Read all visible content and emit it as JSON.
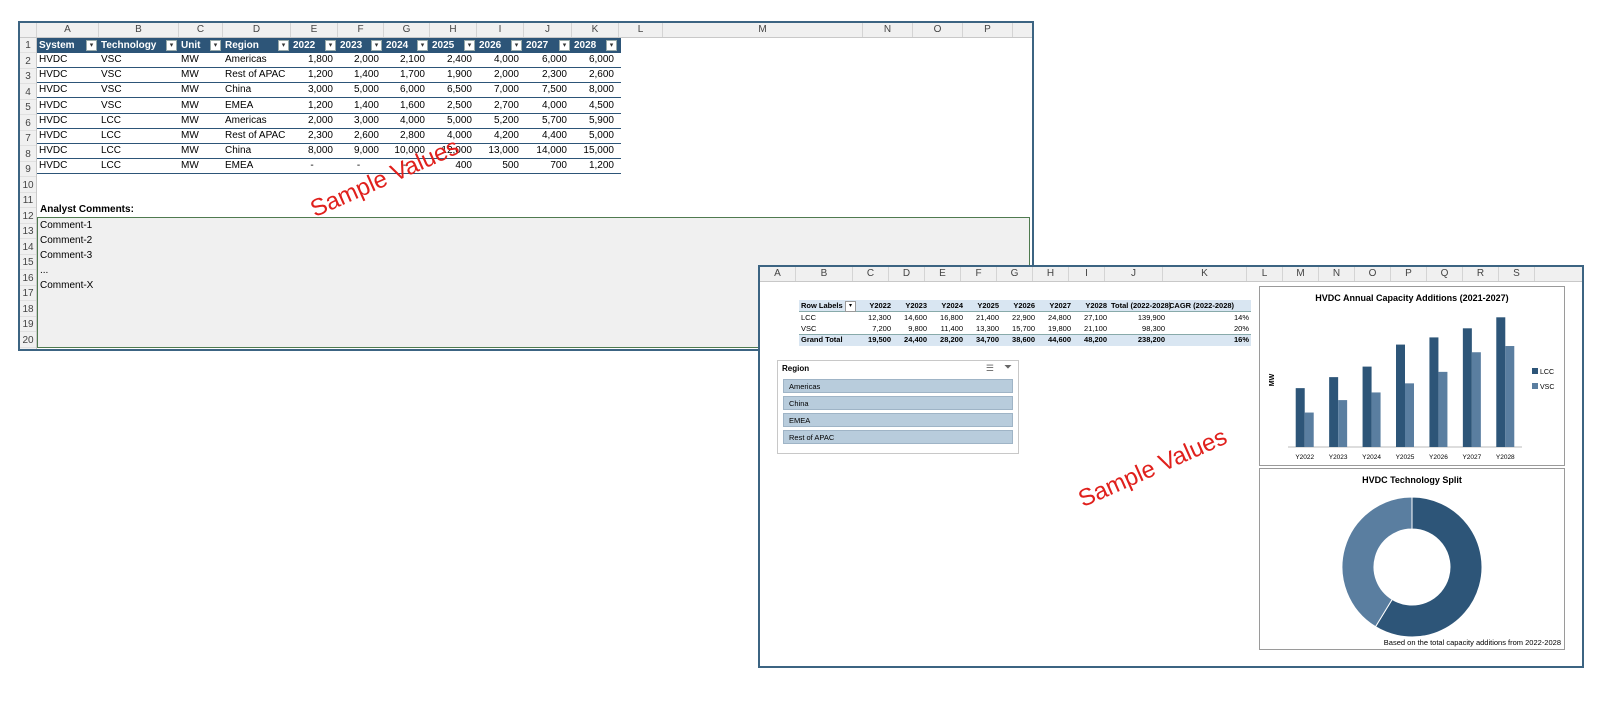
{
  "sheet1": {
    "columns": [
      "A",
      "B",
      "C",
      "D",
      "E",
      "F",
      "G",
      "H",
      "I",
      "J",
      "K",
      "L",
      "M",
      "N",
      "O",
      "P"
    ],
    "rows": [
      "1",
      "2",
      "3",
      "4",
      "5",
      "6",
      "7",
      "8",
      "9",
      "10",
      "11",
      "12",
      "13",
      "14",
      "15",
      "16",
      "17",
      "18",
      "19",
      "20"
    ],
    "table_headers": [
      "System",
      "Technology",
      "Unit",
      "Region",
      "2022",
      "2023",
      "2024",
      "2025",
      "2026",
      "2027",
      "2028"
    ],
    "table_rows": [
      [
        "HVDC",
        "VSC",
        "MW",
        "Americas",
        "1,800",
        "2,000",
        "2,100",
        "2,400",
        "4,000",
        "6,000",
        "6,000"
      ],
      [
        "HVDC",
        "VSC",
        "MW",
        "Rest of APAC",
        "1,200",
        "1,400",
        "1,700",
        "1,900",
        "2,000",
        "2,300",
        "2,600"
      ],
      [
        "HVDC",
        "VSC",
        "MW",
        "China",
        "3,000",
        "5,000",
        "6,000",
        "6,500",
        "7,000",
        "7,500",
        "8,000"
      ],
      [
        "HVDC",
        "VSC",
        "MW",
        "EMEA",
        "1,200",
        "1,400",
        "1,600",
        "2,500",
        "2,700",
        "4,000",
        "4,500"
      ],
      [
        "HVDC",
        "LCC",
        "MW",
        "Americas",
        "2,000",
        "3,000",
        "4,000",
        "5,000",
        "5,200",
        "5,700",
        "5,900"
      ],
      [
        "HVDC",
        "LCC",
        "MW",
        "Rest of APAC",
        "2,300",
        "2,600",
        "2,800",
        "4,000",
        "4,200",
        "4,400",
        "5,000"
      ],
      [
        "HVDC",
        "LCC",
        "MW",
        "China",
        "8,000",
        "9,000",
        "10,000",
        "12,000",
        "13,000",
        "14,000",
        "15,000"
      ],
      [
        "HVDC",
        "LCC",
        "MW",
        "EMEA",
        "-",
        "-",
        "-",
        "400",
        "500",
        "700",
        "1,200"
      ]
    ],
    "analyst_label": "Analyst Comments:",
    "comments": [
      "Comment-1",
      "Comment-2",
      "Comment-3",
      "...",
      "Comment-X"
    ],
    "watermark": "Sample Values"
  },
  "sheet2": {
    "columns": [
      "A",
      "B",
      "C",
      "D",
      "E",
      "F",
      "G",
      "H",
      "I",
      "J",
      "K",
      "L",
      "M",
      "N",
      "O",
      "P",
      "Q",
      "R",
      "S"
    ],
    "pivot": {
      "headers": [
        "Row Labels",
        "Y2022",
        "Y2023",
        "Y2024",
        "Y2025",
        "Y2026",
        "Y2027",
        "Y2028",
        "Total (2022-2028)",
        "CAGR (2022-2028)"
      ],
      "rows": [
        [
          "LCC",
          "12,300",
          "14,600",
          "16,800",
          "21,400",
          "22,900",
          "24,800",
          "27,100",
          "139,900",
          "14%"
        ],
        [
          "VSC",
          "7,200",
          "9,800",
          "11,400",
          "13,300",
          "15,700",
          "19,800",
          "21,100",
          "98,300",
          "20%"
        ]
      ],
      "total": [
        "Grand Total",
        "19,500",
        "24,400",
        "28,200",
        "34,700",
        "38,600",
        "44,600",
        "48,200",
        "238,200",
        "16%"
      ]
    },
    "slicer": {
      "title": "Region",
      "items": [
        "Americas",
        "China",
        "EMEA",
        "Rest of APAC"
      ]
    },
    "watermark": "Sample Values",
    "colors": {
      "lcc": "#2d5578",
      "vsc": "#5a7ea0"
    },
    "donut_footnote": "Based on the total capacity additions from 2022-2028"
  },
  "chart_data": [
    {
      "type": "bar",
      "title": "HVDC Annual Capacity Additions (2021-2027)",
      "ylabel": "MW",
      "categories": [
        "Y2022",
        "Y2023",
        "Y2024",
        "Y2025",
        "Y2026",
        "Y2027",
        "Y2028"
      ],
      "series": [
        {
          "name": "LCC",
          "values": [
            12300,
            14600,
            16800,
            21400,
            22900,
            24800,
            27100
          ]
        },
        {
          "name": "VSC",
          "values": [
            7200,
            9800,
            11400,
            13300,
            15700,
            19800,
            21100
          ]
        }
      ],
      "ylim": [
        0,
        28000
      ],
      "legend": "right",
      "grid": false
    },
    {
      "type": "pie",
      "title": "HVDC Technology Split",
      "categories": [
        "LCC",
        "VSC"
      ],
      "values": [
        139900,
        98300
      ],
      "donut": true,
      "legend": "none"
    }
  ]
}
